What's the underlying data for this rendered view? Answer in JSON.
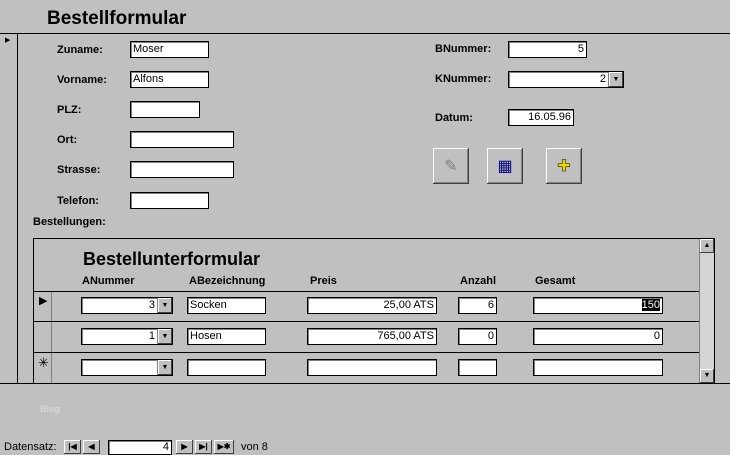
{
  "form": {
    "title": "Bestellformular",
    "fields": {
      "zuname": {
        "label": "Zuname:",
        "value": "Moser"
      },
      "vorname": {
        "label": "Vorname:",
        "value": "Alfons"
      },
      "plz": {
        "label": "PLZ:",
        "value": ""
      },
      "ort": {
        "label": "Ort:",
        "value": ""
      },
      "strasse": {
        "label": "Strasse:",
        "value": ""
      },
      "telefon": {
        "label": "Telefon:",
        "value": ""
      },
      "bnummer": {
        "label": "BNummer:",
        "value": "5"
      },
      "knummer": {
        "label": "KNummer:",
        "value": "2"
      },
      "datum": {
        "label": "Datum:",
        "value": "16.05.96"
      }
    },
    "bestellungen_label": "Bestellungen:"
  },
  "subform": {
    "title": "Bestellunterformular",
    "headers": [
      "ANummer",
      "ABezeichnung",
      "Preis",
      "Anzahl",
      "Gesamt"
    ],
    "rows": [
      {
        "anummer": "3",
        "abez": "Socken",
        "preis": "25,00 ATS",
        "anzahl": "6",
        "gesamt": "150"
      },
      {
        "anummer": "1",
        "abez": "Hosen",
        "preis": "765,00 ATS",
        "anzahl": "0",
        "gesamt": "0"
      },
      {
        "anummer": "",
        "abez": "",
        "preis": "",
        "anzahl": "",
        "gesamt": ""
      }
    ]
  },
  "watermark": "Blog",
  "nav": {
    "label": "Datensatz:",
    "current": "4",
    "total_label": "von 8"
  }
}
